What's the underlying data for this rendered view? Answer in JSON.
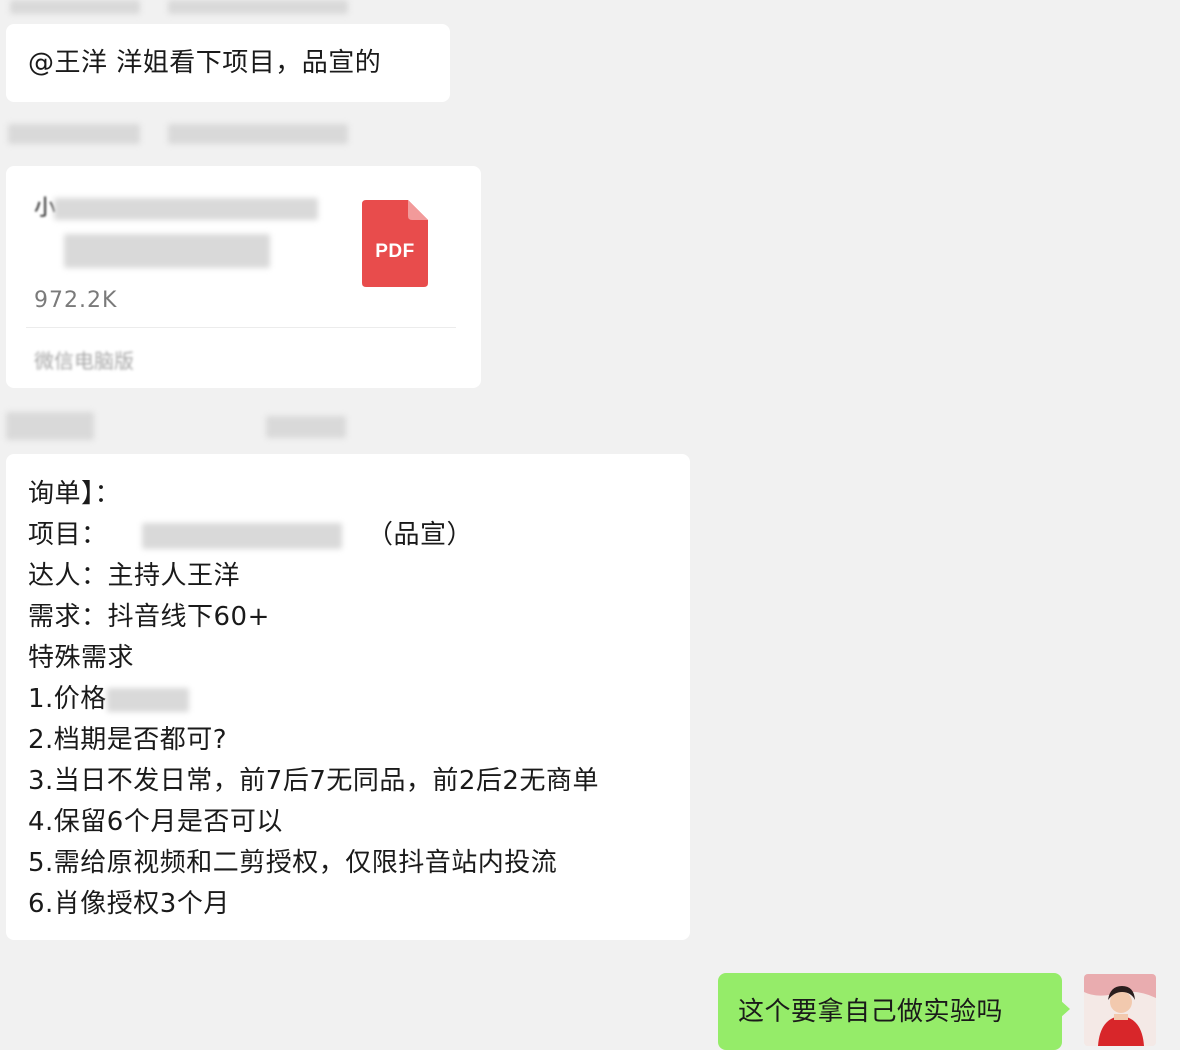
{
  "messages": {
    "mention": {
      "text": "@王洋 洋姐看下项目，品宣的"
    },
    "file": {
      "name_partial": "小",
      "size": "972.2K",
      "source": "微信电脑版",
      "type_label": "PDF"
    },
    "inquiry": {
      "title": "询单】：",
      "project_label": "项目：",
      "project_suffix": "（品宣）",
      "talent": "达人：主持人王洋",
      "demand": "需求：抖音线下60+",
      "special_heading": "特殊需求",
      "item1_prefix": "1.价格",
      "item2": "2.档期是否都可?",
      "item3": "3.当日不发日常，前7后7无同品，前2后2无商单",
      "item4": "4.保留6个月是否可以",
      "item5": "5.需给原视频和二剪授权，仅限抖音站内投流",
      "item6": "6.肖像授权3个月"
    },
    "outgoing": {
      "text": "这个要拿自己做实验吗"
    }
  },
  "colors": {
    "background": "#f1f1f1",
    "incoming_bubble": "#ffffff",
    "outgoing_bubble": "#95ec69",
    "pdf_red": "#e84c4c"
  },
  "icons": {
    "file_type": "pdf-icon",
    "avatar": "user-avatar"
  }
}
